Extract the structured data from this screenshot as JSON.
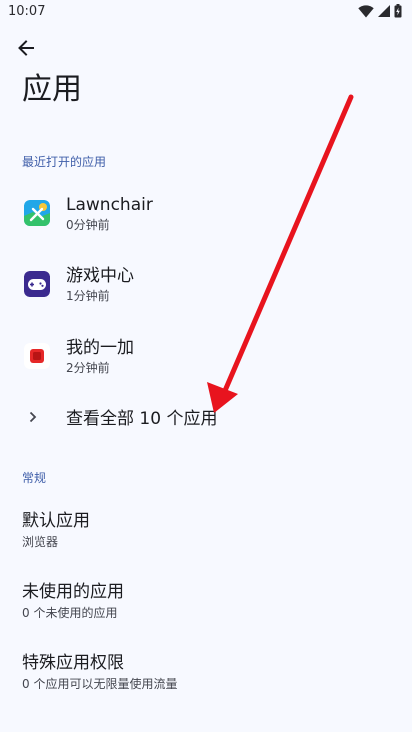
{
  "status_bar": {
    "time": "10:07"
  },
  "header": {
    "title": "应用"
  },
  "recent": {
    "section_label": "最近打开的应用",
    "apps": [
      {
        "name": "Lawnchair",
        "time": "0分钟前",
        "icon": "lawnchair-icon"
      },
      {
        "name": "游戏中心",
        "time": "1分钟前",
        "icon": "game-center-icon"
      },
      {
        "name": "我的一加",
        "time": "2分钟前",
        "icon": "my-oneplus-icon"
      }
    ],
    "see_all_label": "查看全部 10 个应用"
  },
  "general": {
    "section_label": "常规",
    "items": [
      {
        "title": "默认应用",
        "subtitle": "浏览器"
      },
      {
        "title": "未使用的应用",
        "subtitle": "0 个未使用的应用"
      },
      {
        "title": "特殊应用权限",
        "subtitle": "0 个应用可以无限量使用流量"
      }
    ]
  },
  "colors": {
    "background": "#f7f9ff",
    "accent": "#3f5ea9",
    "annotation_arrow": "#e8141e"
  }
}
